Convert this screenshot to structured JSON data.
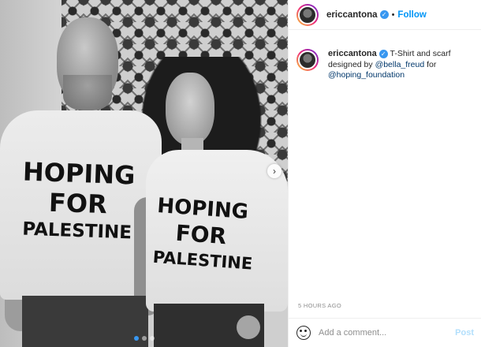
{
  "post": {
    "username": "ericcantona",
    "verified_icon": "verified-badge-icon",
    "separator": "•",
    "follow_label": "Follow",
    "caption_username": "ericcantona",
    "caption_text_1": "T-Shirt and scarf designed by",
    "mention_1": "@bella_freud",
    "caption_text_2": "for",
    "mention_2": "@hoping_foundation",
    "timestamp": "5 HOURS AGO",
    "comment_placeholder": "Add a comment...",
    "post_label": "Post"
  },
  "photo": {
    "shirt_left": {
      "line1": "HOPING",
      "line2": "FOR",
      "line3": "PALESTINE"
    },
    "shirt_right": {
      "line1": "HOPING",
      "line2": "FOR",
      "line3": "PALESTINE"
    },
    "next_icon": "chevron-right-icon",
    "carousel": {
      "count": 3,
      "active_index": 0
    }
  },
  "colors": {
    "accent": "#0095f6",
    "verified": "#3897f0",
    "mention": "#00376b",
    "muted": "#8e8e8e",
    "post_disabled": "#b2dffc"
  }
}
